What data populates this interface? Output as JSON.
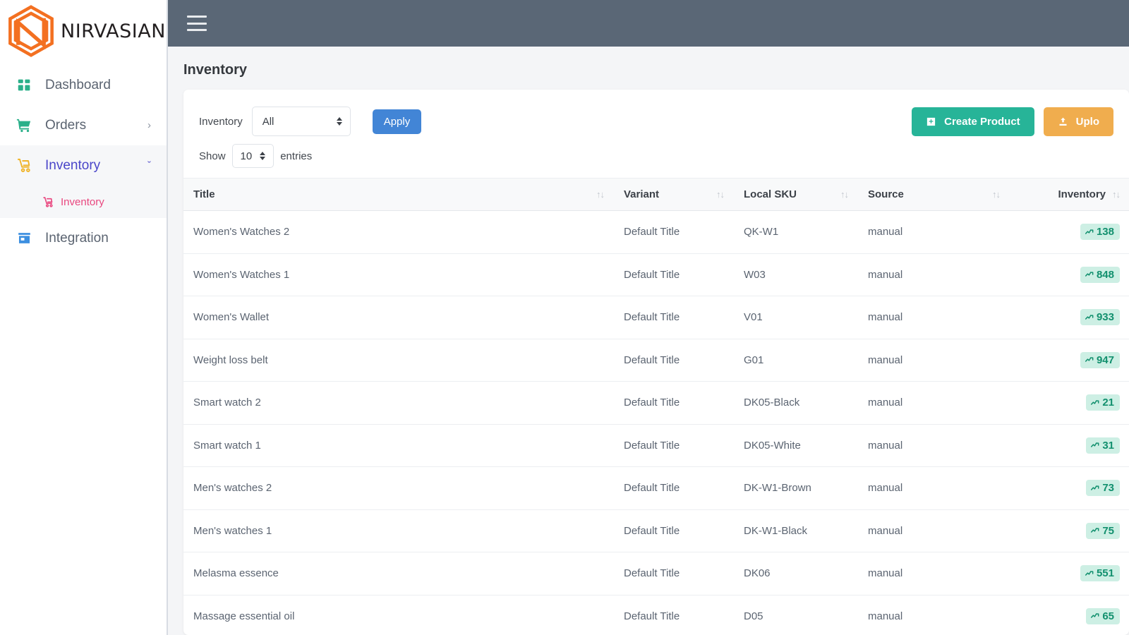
{
  "brand": {
    "name": "NIRVASIAN",
    "logo_icon": "hexagon-n-logo",
    "accent": "#f37021"
  },
  "sidebar": {
    "items": [
      {
        "label": "Dashboard",
        "icon": "grid-dashboard-icon",
        "color": "#2bb08a",
        "caret": "",
        "active": false
      },
      {
        "label": "Orders",
        "icon": "shopping-cart-icon",
        "color": "#2bb08a",
        "caret": "›",
        "active": false
      },
      {
        "label": "Inventory",
        "icon": "hand-truck-icon",
        "color": "#f0b429",
        "caret": "ˇ",
        "active": true
      },
      {
        "label": "Integration",
        "icon": "storefront-icon",
        "color": "#3c8fe0",
        "caret": "",
        "active": false
      }
    ],
    "subitems": [
      {
        "label": "Inventory",
        "icon": "hand-truck-icon",
        "color": "#e9477f"
      }
    ]
  },
  "topbar": {
    "menu_icon": "hamburger-menu-icon"
  },
  "page": {
    "title": "Inventory"
  },
  "toolbar": {
    "filter_label": "Inventory",
    "filter_value": "All",
    "filter_options": [
      "All"
    ],
    "apply_label": "Apply",
    "create_label": "Create Product",
    "create_icon": "plus-square-icon",
    "create_color": "#27b498",
    "upload_label": "Uplo",
    "upload_icon": "upload-icon",
    "upload_color": "#f0ad4e"
  },
  "show_entries": {
    "prefix": "Show",
    "value": "10",
    "options": [
      "10"
    ],
    "suffix": "entries"
  },
  "table": {
    "sort_icon": "sort-updown-icon",
    "columns": [
      {
        "key": "title",
        "label": "Title",
        "align": "left"
      },
      {
        "key": "variant",
        "label": "Variant",
        "align": "left"
      },
      {
        "key": "sku",
        "label": "Local SKU",
        "align": "left"
      },
      {
        "key": "source",
        "label": "Source",
        "align": "left"
      },
      {
        "key": "inventory",
        "label": "Inventory",
        "align": "right"
      }
    ],
    "badge_icon": "trending-up-icon",
    "badge_bg": "#cdefe4",
    "badge_fg": "#12906e",
    "rows": [
      {
        "title": "Women's Watches 2",
        "variant": "Default Title",
        "sku": "QK-W1",
        "source": "manual",
        "inventory": "138"
      },
      {
        "title": "Women's Watches 1",
        "variant": "Default Title",
        "sku": "W03",
        "source": "manual",
        "inventory": "848"
      },
      {
        "title": "Women's Wallet",
        "variant": "Default Title",
        "sku": "V01",
        "source": "manual",
        "inventory": "933"
      },
      {
        "title": "Weight loss belt",
        "variant": "Default Title",
        "sku": "G01",
        "source": "manual",
        "inventory": "947"
      },
      {
        "title": "Smart watch 2",
        "variant": "Default Title",
        "sku": "DK05-Black",
        "source": "manual",
        "inventory": "21"
      },
      {
        "title": "Smart watch 1",
        "variant": "Default Title",
        "sku": "DK05-White",
        "source": "manual",
        "inventory": "31"
      },
      {
        "title": "Men's watches 2",
        "variant": "Default Title",
        "sku": "DK-W1-Brown",
        "source": "manual",
        "inventory": "73"
      },
      {
        "title": "Men's watches 1",
        "variant": "Default Title",
        "sku": "DK-W1-Black",
        "source": "manual",
        "inventory": "75"
      },
      {
        "title": "Melasma essence",
        "variant": "Default Title",
        "sku": "DK06",
        "source": "manual",
        "inventory": "551"
      },
      {
        "title": "Massage essential oil",
        "variant": "Default Title",
        "sku": "D05",
        "source": "manual",
        "inventory": "65"
      }
    ]
  }
}
